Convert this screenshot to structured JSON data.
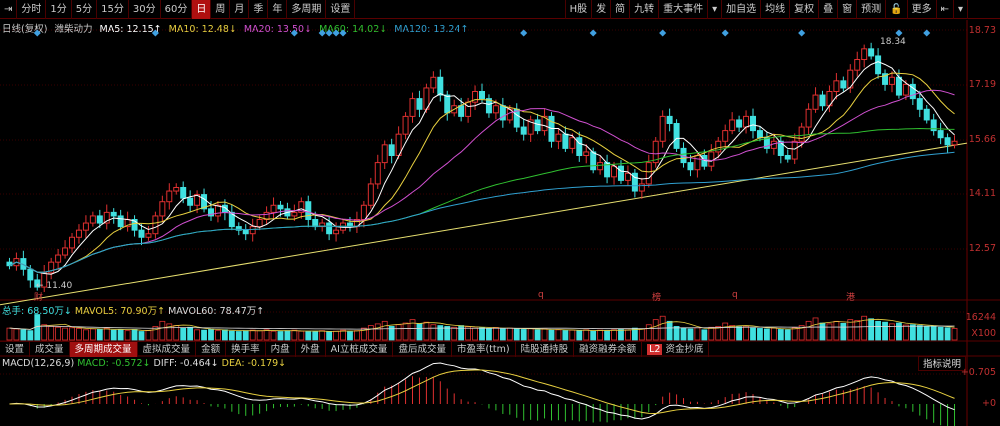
{
  "toolbar": {
    "left": [
      "⇥",
      "分时",
      "1分",
      "5分",
      "15分",
      "30分",
      "60分",
      "日",
      "周",
      "月",
      "季",
      "年",
      "多周期",
      "设置"
    ],
    "active": "日",
    "right": [
      "H股",
      "发",
      "简",
      "九转",
      "重大事件",
      "▾",
      "加自选",
      "均线",
      "复权",
      "叠",
      "窗",
      "预测",
      "🔓",
      "更多",
      "⇤",
      "▾"
    ]
  },
  "legend": {
    "period": "日线(复权)",
    "name": "潍柴动力",
    "ma5": "MA5: 12.15↑",
    "ma10": "MA10: 12.48↓",
    "ma20": "MA20: 13.50↓",
    "ma60": "MA60: 14.02↓",
    "ma120": "MA120: 13.24↑"
  },
  "colors": {
    "ma5": "#ffffff",
    "ma10": "#e8d040",
    "ma20": "#d050d0",
    "ma60": "#30c030",
    "ma120": "#30a0d0",
    "up": "#e03030",
    "down": "#40e0e0",
    "trend": "#e8e070",
    "grid": "#3a0000"
  },
  "price_axis": [
    "18.73",
    "17.19",
    "15.66",
    "14.11",
    "12.57"
  ],
  "annotations": {
    "high": "18.34",
    "low": "← 11.40"
  },
  "events": [
    "财",
    "q",
    "榜",
    "q",
    "港"
  ],
  "volume": {
    "total": "总手: 68.50万↓",
    "mavol5": "MAVOL5: 70.90万↑",
    "mavol60": "MAVOL60: 78.47万↑",
    "axis_top": "16244",
    "axis_bottom": "X100"
  },
  "tabs": [
    "设置",
    "成交量",
    "多周期成交量",
    "虚拟成交量",
    "金额",
    "换手率",
    "内盘",
    "外盘",
    "AI立桩成交量",
    "盘后成交量",
    "市盈率(ttm)",
    "陆股通持股",
    "融资融券余额",
    "资金抄底"
  ],
  "active_tab": "多周期成交量",
  "l2_badge": "L2",
  "macd": {
    "params": "MACD(12,26,9)",
    "macd": "MACD: -0.572↓",
    "diff": "DIFF: -0.464↓",
    "dea": "DEA: -0.179↓",
    "axis_top": "+0.705",
    "axis_zero": "+0",
    "button": "指标说明"
  },
  "chart_data": {
    "type": "candlestick",
    "price_range": [
      11.0,
      19.1
    ],
    "closes": [
      12.1,
      12.3,
      12.0,
      11.7,
      11.5,
      11.9,
      12.2,
      12.4,
      12.6,
      12.9,
      13.1,
      13.3,
      13.5,
      13.3,
      13.6,
      13.5,
      13.2,
      13.4,
      13.1,
      12.9,
      13.0,
      13.5,
      13.9,
      14.2,
      14.3,
      14.0,
      13.8,
      14.1,
      13.7,
      13.5,
      13.8,
      13.6,
      13.2,
      13.1,
      13.0,
      13.2,
      13.4,
      13.6,
      13.8,
      13.7,
      13.5,
      13.6,
      13.9,
      13.4,
      13.2,
      13.3,
      13.0,
      13.1,
      13.3,
      13.2,
      13.4,
      13.8,
      14.4,
      15.0,
      15.5,
      15.2,
      15.8,
      16.3,
      16.8,
      16.5,
      17.1,
      17.4,
      16.9,
      16.4,
      16.6,
      16.3,
      16.7,
      17.0,
      16.8,
      16.4,
      16.6,
      16.2,
      16.5,
      16.0,
      15.8,
      16.2,
      15.9,
      16.3,
      15.6,
      15.8,
      15.4,
      15.7,
      15.2,
      15.3,
      14.8,
      15.0,
      14.6,
      14.9,
      14.5,
      14.7,
      14.2,
      14.4,
      15.0,
      15.6,
      16.3,
      16.1,
      15.4,
      15.0,
      14.8,
      15.2,
      14.9,
      15.3,
      15.6,
      15.9,
      16.2,
      16.0,
      16.3,
      15.9,
      15.7,
      15.4,
      15.6,
      15.2,
      15.1,
      15.6,
      16.0,
      16.5,
      16.9,
      16.6,
      17.0,
      17.3,
      17.1,
      17.6,
      17.9,
      18.2,
      18.0,
      17.5,
      17.2,
      17.4,
      16.9,
      17.2,
      16.8,
      16.5,
      16.2,
      15.9,
      15.7,
      15.5,
      15.6
    ],
    "volumes": [
      70,
      65,
      60,
      55,
      150,
      90,
      80,
      75,
      70,
      72,
      68,
      60,
      65,
      62,
      70,
      58,
      60,
      55,
      62,
      50,
      55,
      80,
      110,
      95,
      85,
      70,
      75,
      60,
      58,
      62,
      55,
      60,
      52,
      50,
      55,
      58,
      55,
      60,
      52,
      50,
      55,
      58,
      52,
      50,
      48,
      55,
      50,
      52,
      58,
      50,
      55,
      70,
      85,
      95,
      110,
      80,
      90,
      100,
      120,
      95,
      105,
      90,
      85,
      80,
      75,
      85,
      78,
      70,
      72,
      68,
      74,
      65,
      70,
      66,
      62,
      68,
      60,
      64,
      58,
      60,
      56,
      58,
      55,
      60,
      52,
      58,
      55,
      60,
      62,
      58,
      70,
      65,
      90,
      120,
      140,
      110,
      80,
      70,
      65,
      72,
      60,
      75,
      80,
      100,
      85,
      78,
      82,
      70,
      68,
      65,
      70,
      62,
      60,
      72,
      85,
      110,
      130,
      100,
      95,
      110,
      98,
      120,
      115,
      140,
      125,
      110,
      105,
      95,
      100,
      88,
      90,
      85,
      80,
      82,
      75,
      72,
      68.5
    ],
    "volume_unit": "万",
    "signal_bars": [
      4,
      21,
      41,
      45,
      46,
      47,
      48,
      74,
      84,
      94,
      103,
      114,
      128,
      132
    ]
  }
}
